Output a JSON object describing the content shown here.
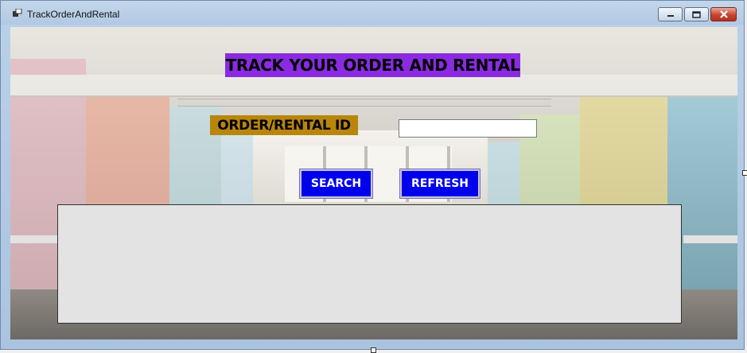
{
  "window": {
    "title": "TrackOrderAndRental",
    "app_icon": "form-icon",
    "controls": {
      "minimize_icon": "minimize-icon",
      "maximize_icon": "maximize-icon",
      "close_icon": "close-icon"
    }
  },
  "form": {
    "heading": "TRACK YOUR ORDER AND RENTAL",
    "id_label": "ORDER/RENTAL ID",
    "id_input_value": "",
    "search_button": "SEARCH",
    "refresh_button": "REFRESH"
  },
  "colors": {
    "heading_bg": "#8a2be2",
    "label_bg": "#b8860b",
    "button_bg": "#0000ee",
    "grid_bg": "#e3e3e3"
  }
}
